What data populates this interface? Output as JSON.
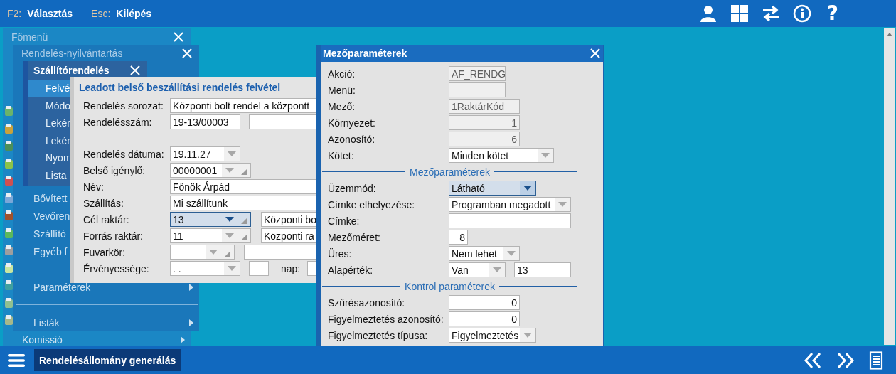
{
  "top_bar": {
    "shortcuts": [
      {
        "key": "F2:",
        "action": "Választás"
      },
      {
        "key": "Esc:",
        "action": "Kilépés"
      }
    ],
    "help_button": "?"
  },
  "main_menu": {
    "title": "Főmenü",
    "items": [
      {
        "label": "Komissió",
        "has_submenu": true
      }
    ]
  },
  "order_menu": {
    "title": "Rendelés-nyilvántartás",
    "items": [
      {
        "kind": "item",
        "label": "Bővített"
      },
      {
        "kind": "item",
        "label": "Vevőren"
      },
      {
        "kind": "item",
        "label": "Szállító"
      },
      {
        "kind": "item",
        "label": "Egyéb f"
      },
      {
        "kind": "divider"
      },
      {
        "kind": "item",
        "label": "Paraméterek",
        "has_submenu": true
      },
      {
        "kind": "divider"
      },
      {
        "kind": "item",
        "label": "Listák",
        "has_submenu": true
      }
    ]
  },
  "supplier_menu": {
    "title": "Szállítórendelés",
    "items": [
      {
        "label": "Felvé",
        "selected": true
      },
      {
        "label": "Módo",
        "selected": false
      },
      {
        "label": "Lekér",
        "selected": false
      },
      {
        "label": "Lekér",
        "selected": false
      },
      {
        "label": "Nyom",
        "selected": false
      },
      {
        "label": "Lista",
        "selected": false
      }
    ]
  },
  "order_form": {
    "title": "Leadott belső beszállítási rendelés felvétel",
    "rows": [
      {
        "label": "Rendelés sorozat:",
        "controls": [
          {
            "kind": "text",
            "value": "Központi bolt rendel a központt",
            "focused": false
          }
        ]
      },
      {
        "label": "Rendelésszám:",
        "controls": [
          {
            "kind": "text",
            "value": "19-13/00003",
            "focused": false
          },
          {
            "kind": "text",
            "focused": false
          }
        ]
      },
      {
        "label": "Rendelés dátuma:",
        "controls": [
          {
            "kind": "combo",
            "value": "19.11.27",
            "focused": false
          }
        ]
      },
      {
        "label": "Belső igénylő:",
        "controls": [
          {
            "kind": "lookup",
            "value": "00000001",
            "focused": false
          }
        ]
      },
      {
        "label": "Név:",
        "controls": [
          {
            "kind": "text",
            "value": "Főnök Árpád",
            "focused": false
          }
        ]
      },
      {
        "label": "Szállítás:",
        "controls": [
          {
            "kind": "text",
            "value": "Mi szállítunk",
            "focused": false
          }
        ]
      },
      {
        "label": "Cél raktár:",
        "controls": [
          {
            "kind": "lookup",
            "value": "13",
            "focused": true
          },
          {
            "kind": "text",
            "value": "Központi bo",
            "focused": false
          }
        ]
      },
      {
        "label": "Forrás raktár:",
        "controls": [
          {
            "kind": "lookup",
            "value": "11",
            "focused": false
          },
          {
            "kind": "text",
            "value": "Központi ra",
            "focused": false
          }
        ]
      },
      {
        "label": "Fuvarkör:",
        "controls": [
          {
            "kind": "lookup",
            "focused": false
          },
          {
            "kind": "text",
            "focused": false
          }
        ]
      },
      {
        "label": "Érvényessége:",
        "controls": [
          {
            "kind": "combo",
            "value": ". .",
            "focused": false
          },
          {
            "kind": "text",
            "focused": false
          },
          {
            "kind": "label",
            "value": "nap:"
          },
          {
            "kind": "text",
            "focused": false
          }
        ]
      }
    ]
  },
  "field_dialog": {
    "title": "Mezőparaméterek",
    "rows": [
      {
        "kind": "field",
        "label": "Akció:",
        "controls": [
          {
            "kind": "readonly",
            "value": "AF_RENDG",
            "focused": false
          }
        ]
      },
      {
        "kind": "field",
        "label": "Menü:",
        "controls": [
          {
            "kind": "readonly",
            "focused": false
          }
        ]
      },
      {
        "kind": "field",
        "label": "Mező:",
        "controls": [
          {
            "kind": "readonly",
            "value": "1RaktárKód",
            "focused": false
          }
        ]
      },
      {
        "kind": "field",
        "label": "Környezet:",
        "controls": [
          {
            "kind": "readonly-number",
            "value": "1",
            "focused": false
          }
        ]
      },
      {
        "kind": "field",
        "label": "Azonosító:",
        "controls": [
          {
            "kind": "readonly-number",
            "value": "6",
            "focused": false
          }
        ]
      },
      {
        "kind": "field",
        "label": "Kötet:",
        "controls": [
          {
            "kind": "combo",
            "value": "Minden kötet",
            "focused": false
          }
        ]
      },
      {
        "kind": "section",
        "label": "Mezőparaméterek"
      },
      {
        "kind": "field",
        "label": "Üzemmód:",
        "controls": [
          {
            "kind": "combo",
            "value": "Látható",
            "focused": true
          }
        ]
      },
      {
        "kind": "field",
        "label": "Címke elhelyezése:",
        "controls": [
          {
            "kind": "combo",
            "value": "Programban megadott",
            "focused": false
          }
        ]
      },
      {
        "kind": "field",
        "label": "Címke:",
        "controls": [
          {
            "kind": "text",
            "focused": false
          }
        ]
      },
      {
        "kind": "field",
        "label": "Mezőméret:",
        "controls": [
          {
            "kind": "number",
            "value": "8",
            "focused": false
          }
        ]
      },
      {
        "kind": "field",
        "label": "Üres:",
        "controls": [
          {
            "kind": "combo",
            "value": "Nem lehet",
            "focused": false
          }
        ]
      },
      {
        "kind": "field",
        "label": "Alapérték:",
        "controls": [
          {
            "kind": "combo",
            "value": "Van",
            "focused": false
          },
          {
            "kind": "text",
            "value": "13",
            "focused": false
          }
        ]
      },
      {
        "kind": "section",
        "label": "Kontrol paraméterek"
      },
      {
        "kind": "field",
        "label": "Szűrésazonosító:",
        "controls": [
          {
            "kind": "number",
            "value": "0",
            "focused": false
          }
        ]
      },
      {
        "kind": "field",
        "label": "Figyelmeztetés azonosító:",
        "controls": [
          {
            "kind": "number",
            "value": "0",
            "focused": false
          }
        ]
      },
      {
        "kind": "field",
        "label": "Figyelmeztetés típusa:",
        "controls": [
          {
            "kind": "combo",
            "value": "Figyelmeztetés",
            "focused": false
          }
        ]
      }
    ]
  },
  "bottom_bar": {
    "action_button": "Rendelésállomány generálás"
  }
}
